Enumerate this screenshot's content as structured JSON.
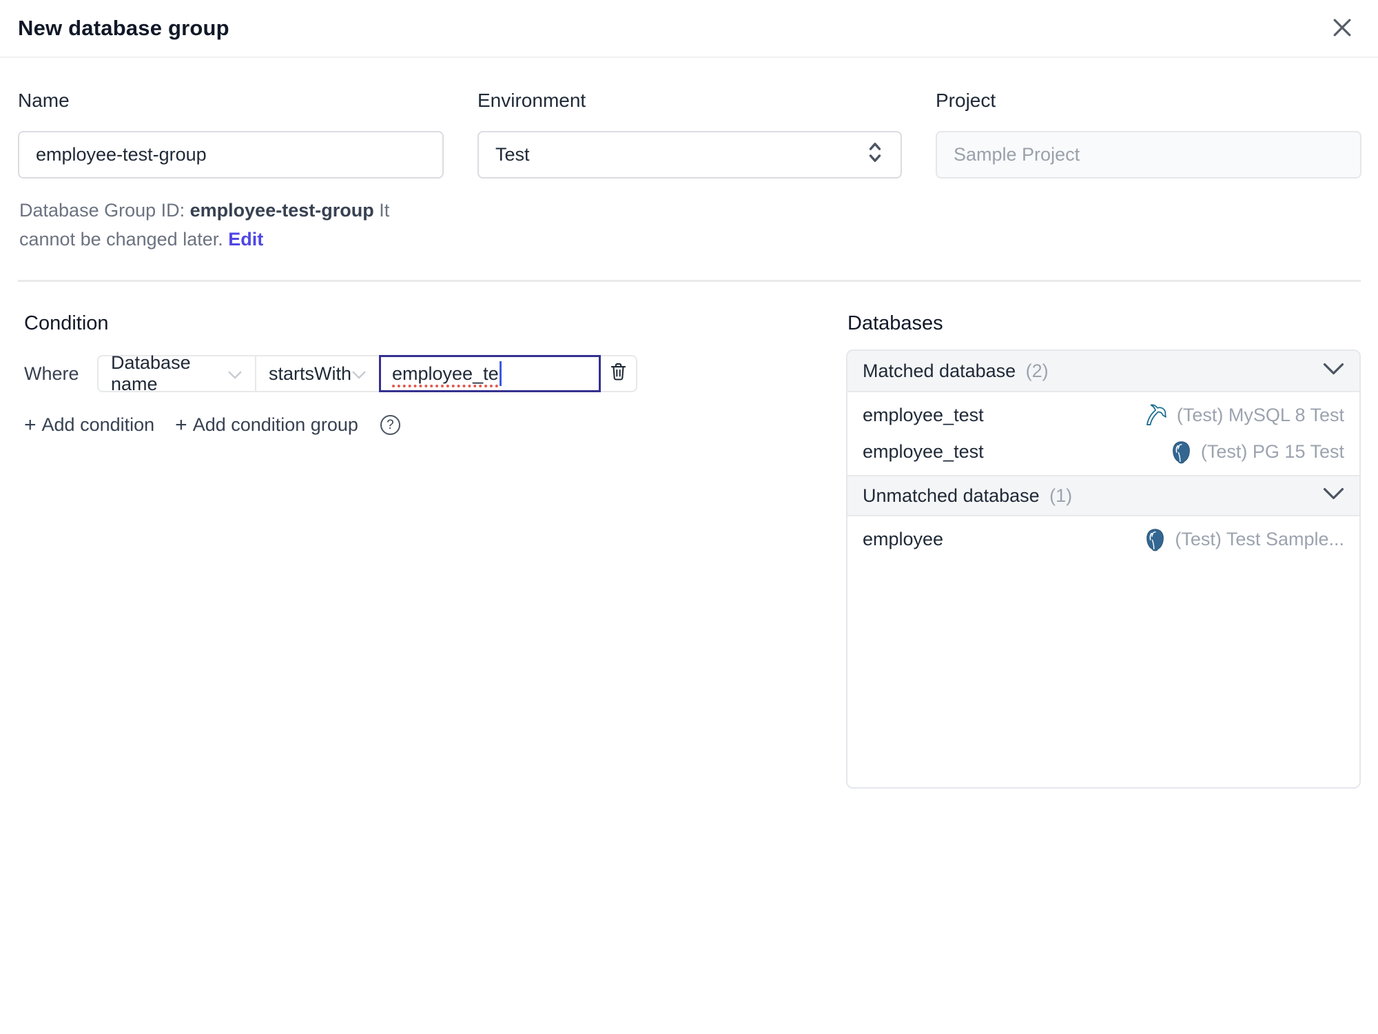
{
  "dialog": {
    "title": "New database group"
  },
  "form": {
    "name": {
      "label": "Name",
      "value": "employee-test-group"
    },
    "environment": {
      "label": "Environment",
      "value": "Test"
    },
    "project": {
      "label": "Project",
      "value": "Sample Project"
    },
    "group_id_help": {
      "prefix": "Database Group ID:",
      "id": "employee-test-group",
      "suffix": "It cannot be changed later.",
      "edit_link": "Edit"
    }
  },
  "condition": {
    "heading": "Condition",
    "where_label": "Where",
    "field_select": {
      "value": "Database name"
    },
    "operator_select": {
      "value": "startsWith"
    },
    "value_input": {
      "value": "employee_te"
    },
    "add_condition_label": "Add condition",
    "add_condition_group_label": "Add condition group",
    "plus_icon": "+",
    "help_icon": "?"
  },
  "databases": {
    "heading": "Databases",
    "matched": {
      "title": "Matched database",
      "count": "(2)",
      "rows": [
        {
          "name": "employee_test",
          "engine": "mysql",
          "instance": "(Test) MySQL 8 Test"
        },
        {
          "name": "employee_test",
          "engine": "postgresql",
          "instance": "(Test) PG 15 Test"
        }
      ]
    },
    "unmatched": {
      "title": "Unmatched database",
      "count": "(1)",
      "rows": [
        {
          "name": "employee",
          "engine": "postgresql",
          "instance": "(Test) Test Sample..."
        }
      ]
    }
  },
  "colors": {
    "accent_indigo": "#4f46e5",
    "focus_border": "#34308f",
    "mysql_icon": "#1d6e8f",
    "postgres_icon": "#336791",
    "muted_text": "#9ca3af",
    "spellcheck_red": "#e2594e"
  }
}
